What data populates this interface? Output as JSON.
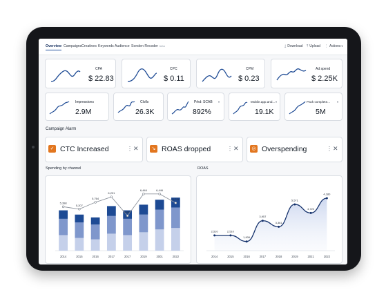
{
  "nav": {
    "tabs": [
      "Overview",
      "Campaigns",
      "Creatives",
      "Keywords",
      "Audience",
      "Sonden Recoder"
    ],
    "beta_badge": "beta",
    "actions": [
      {
        "label": "Download",
        "icon": "download-icon"
      },
      {
        "label": "Upload",
        "icon": "upload-icon"
      },
      {
        "label": "Actions",
        "icon": "chevron-down-icon"
      }
    ]
  },
  "kpis_row1": [
    {
      "label": "CPA",
      "value": "$ 22.83"
    },
    {
      "label": "CPC",
      "value": "$ 0.11"
    },
    {
      "label": "CPM",
      "value": "$ 0.23"
    },
    {
      "label": "Ad spend",
      "value": "$ 2.25K"
    }
  ],
  "kpis_row2": [
    {
      "label": "Impressions",
      "value": "2.9M"
    },
    {
      "label": "Clolls",
      "value": "26.3K"
    },
    {
      "label": "Prkd: SCAB",
      "value": "892%"
    },
    {
      "label": "Mobile.app.and...",
      "value": "19.1K"
    },
    {
      "label": "Pack complete...",
      "value": "5M"
    }
  ],
  "alarm": {
    "title": "Campaign Alarm",
    "items": [
      {
        "text": "CTC Increased",
        "icon": "alert-icon"
      },
      {
        "text": "ROAS dropped",
        "icon": "alert-icon"
      },
      {
        "text": "Overspending",
        "icon": "alert-icon"
      }
    ],
    "menu_glyph": "⋮",
    "close_glyph": "✕"
  },
  "colors": {
    "accent_dark": "#1d4a94",
    "accent_mid": "#7f97cc",
    "accent_light": "#c5d0ea",
    "alarm_orange": "#e2761f",
    "line_navy": "#13306b"
  },
  "chart_data": [
    {
      "type": "bar",
      "title": "Spending by channel",
      "categories": [
        "2014",
        "2015",
        "2016",
        "2017",
        "2017",
        "2019",
        "2001",
        "2022"
      ],
      "series": [
        {
          "values": [
            22,
            18,
            16,
            24,
            22,
            26,
            30,
            32
          ]
        },
        {
          "values": [
            23,
            22,
            21,
            25,
            23,
            25,
            28,
            29
          ]
        },
        {
          "values": [
            12,
            11,
            10,
            14,
            12,
            14,
            14,
            14
          ]
        }
      ],
      "line_values": [
        5398,
        5207,
        5764,
        6201,
        4661,
        6446,
        6446,
        5711
      ],
      "data_labels": [
        "5,398",
        "5,207",
        "5,764",
        "6,201",
        "4,661",
        "6,446",
        "6,446",
        "5,711"
      ],
      "ylim": [
        0,
        80
      ],
      "stacked": true,
      "grid": false
    },
    {
      "type": "area",
      "title": "ROAS",
      "categories": [
        "2014",
        "2015",
        "2016",
        "2017",
        "2018",
        "2019",
        "2021",
        "2022"
      ],
      "values": [
        2510,
        2510,
        1906,
        3957,
        3361,
        5571,
        4722,
        6180
      ],
      "data_labels": [
        "2,510",
        "2,510",
        "1,906",
        "3,957",
        "3,361",
        "5,571",
        "4,722",
        "4,180"
      ],
      "ylim": [
        1000,
        7000
      ],
      "grid": false
    }
  ]
}
